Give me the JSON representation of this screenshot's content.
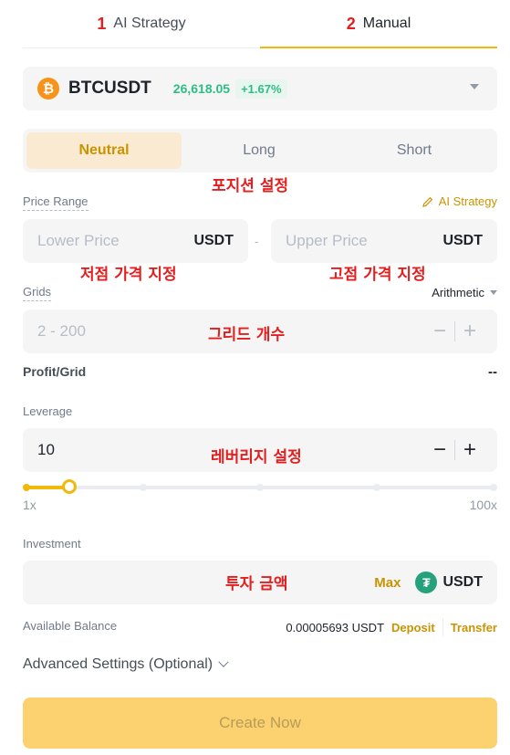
{
  "tabs": [
    {
      "number": "1",
      "label": "AI Strategy"
    },
    {
      "number": "2",
      "label": "Manual"
    }
  ],
  "pair": {
    "name": "BTCUSDT",
    "price": "26,618.05",
    "change": "+1.67%",
    "coin_glyph": "₿",
    "icon": "bitcoin-icon"
  },
  "position": {
    "options": [
      "Neutral",
      "Long",
      "Short"
    ],
    "selected": "Neutral"
  },
  "price_range": {
    "label": "Price Range",
    "ai_link": "AI Strategy",
    "lower_placeholder": "Lower Price",
    "upper_placeholder": "Upper Price",
    "unit": "USDT",
    "separator": "-"
  },
  "grids": {
    "label": "Grids",
    "mode": "Arithmetic",
    "placeholder": "2 - 200"
  },
  "profit": {
    "label": "Profit/Grid",
    "value": "--"
  },
  "leverage": {
    "label": "Leverage",
    "value": "10",
    "min_label": "1x",
    "max_label": "100x",
    "fraction": 0.091
  },
  "investment": {
    "label": "Investment",
    "max_label": "Max",
    "unit": "USDT",
    "coin_glyph": "₮"
  },
  "balance": {
    "label": "Available Balance",
    "value": "0.00005693 USDT",
    "deposit": "Deposit",
    "transfer": "Transfer"
  },
  "advanced": {
    "label": "Advanced Settings (Optional)"
  },
  "create_button": "Create Now",
  "annotations": {
    "position": "포지션 설정",
    "lower": "저점 가격 지정",
    "upper": "고점 가격 지정",
    "grids": "그리드 개수",
    "leverage": "레버리지 설정",
    "investment": "투자 금액"
  },
  "colors": {
    "accent": "#f0b90b",
    "accent_text": "#c99400",
    "up": "#2ebd85",
    "annotation": "#e41e1e",
    "bitcoin": "#f7931a",
    "tether": "#26a17b"
  }
}
